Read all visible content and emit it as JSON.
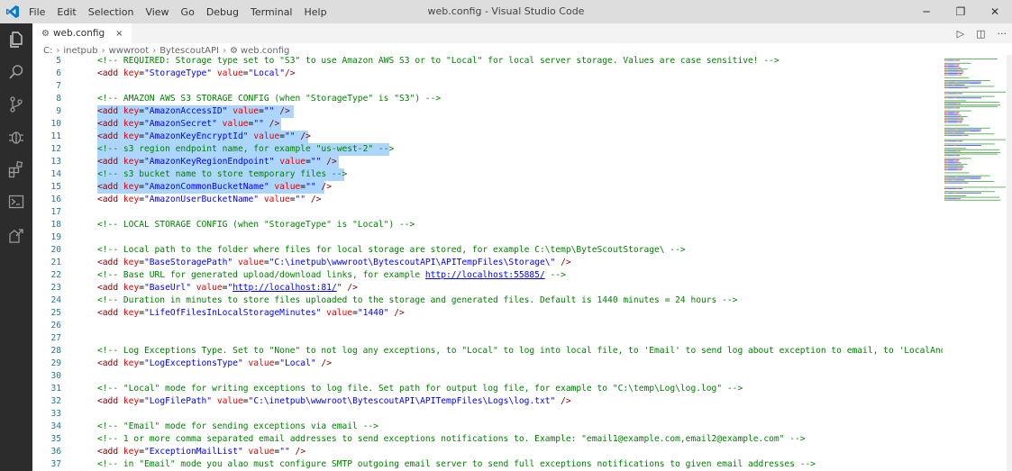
{
  "window": {
    "title": "web.config - Visual Studio Code",
    "minimize": "─",
    "restore": "❐",
    "close": "✕"
  },
  "menu": [
    "File",
    "Edit",
    "Selection",
    "View",
    "Go",
    "Debug",
    "Terminal",
    "Help"
  ],
  "tab": {
    "label": "web.config",
    "close": "×"
  },
  "breadcrumb": [
    "C:",
    "inetpub",
    "wwwroot",
    "BytescoutAPI",
    "web.config"
  ],
  "editor_actions": {
    "run": "▷",
    "split": "◫",
    "more": "···"
  },
  "lines": [
    {
      "n": "5",
      "parts": [
        [
          "c",
          "<!-- REQUIRED: Storage type set to \"S3\" to use Amazon AWS S3 or to \"Local\" for local server storage. Values are case sensitive! -->"
        ]
      ]
    },
    {
      "n": "6",
      "parts": [
        [
          "t",
          "<add "
        ],
        [
          "a",
          "key"
        ],
        [
          "e",
          "="
        ],
        [
          "v",
          "\"StorageType\""
        ],
        [
          "t",
          " "
        ],
        [
          "a",
          "value"
        ],
        [
          "e",
          "="
        ],
        [
          "v",
          "\"Local\""
        ],
        [
          "t",
          "/>"
        ]
      ]
    },
    {
      "n": "7",
      "parts": []
    },
    {
      "n": "8",
      "parts": [
        [
          "c",
          "<!-- AMAZON AWS S3 STORAGE CONFIG (when \"StorageType\" is \"S3\") -->"
        ]
      ]
    },
    {
      "n": "9",
      "parts": [
        [
          "t",
          "<add "
        ],
        [
          "a",
          "key"
        ],
        [
          "e",
          "="
        ],
        [
          "v",
          "\"AmazonAccessID\""
        ],
        [
          "t",
          " "
        ],
        [
          "a",
          "value"
        ],
        [
          "e",
          "="
        ],
        [
          "v",
          "\"\""
        ],
        [
          "t",
          " />"
        ]
      ]
    },
    {
      "n": "10",
      "parts": [
        [
          "t",
          "<add "
        ],
        [
          "a",
          "key"
        ],
        [
          "e",
          "="
        ],
        [
          "v",
          "\"AmazonSecret\""
        ],
        [
          "t",
          " "
        ],
        [
          "a",
          "value"
        ],
        [
          "e",
          "="
        ],
        [
          "v",
          "\"\""
        ],
        [
          "t",
          " />"
        ]
      ]
    },
    {
      "n": "11",
      "parts": [
        [
          "t",
          "<add "
        ],
        [
          "a",
          "key"
        ],
        [
          "e",
          "="
        ],
        [
          "v",
          "\"AmazonKeyEncryptId\""
        ],
        [
          "t",
          " "
        ],
        [
          "a",
          "value"
        ],
        [
          "e",
          "="
        ],
        [
          "v",
          "\"\""
        ],
        [
          "t",
          " />"
        ]
      ]
    },
    {
      "n": "12",
      "parts": [
        [
          "c",
          "<!-- s3 region endpoint name, for example \"us-west-2\" -->"
        ]
      ]
    },
    {
      "n": "13",
      "parts": [
        [
          "t",
          "<add "
        ],
        [
          "a",
          "key"
        ],
        [
          "e",
          "="
        ],
        [
          "v",
          "\"AmazonKeyRegionEndpoint\""
        ],
        [
          "t",
          " "
        ],
        [
          "a",
          "value"
        ],
        [
          "e",
          "="
        ],
        [
          "v",
          "\"\""
        ],
        [
          "t",
          " />"
        ]
      ]
    },
    {
      "n": "14",
      "parts": [
        [
          "c",
          "<!-- s3 bucket name to store temporary files -->"
        ]
      ]
    },
    {
      "n": "15",
      "parts": [
        [
          "t",
          "<add "
        ],
        [
          "a",
          "key"
        ],
        [
          "e",
          "="
        ],
        [
          "v",
          "\"AmazonCommonBucketName\""
        ],
        [
          "t",
          " "
        ],
        [
          "a",
          "value"
        ],
        [
          "e",
          "="
        ],
        [
          "v",
          "\"\""
        ],
        [
          "t",
          " />"
        ]
      ]
    },
    {
      "n": "16",
      "parts": [
        [
          "t",
          "<add "
        ],
        [
          "a",
          "key"
        ],
        [
          "e",
          "="
        ],
        [
          "v",
          "\"AmazonUserBucketName\""
        ],
        [
          "t",
          " "
        ],
        [
          "a",
          "value"
        ],
        [
          "e",
          "="
        ],
        [
          "v",
          "\"\""
        ],
        [
          "t",
          " />"
        ]
      ]
    },
    {
      "n": "17",
      "parts": []
    },
    {
      "n": "18",
      "parts": [
        [
          "c",
          "<!-- LOCAL STORAGE CONFIG (when \"StorageType\" is \"Local\") -->"
        ]
      ]
    },
    {
      "n": "19",
      "parts": []
    },
    {
      "n": "20",
      "parts": [
        [
          "c",
          "<!-- Local path to the folder where files for local storage are stored, for example C:\\temp\\ByteScoutStorage\\ -->"
        ]
      ]
    },
    {
      "n": "21",
      "parts": [
        [
          "t",
          "<add "
        ],
        [
          "a",
          "key"
        ],
        [
          "e",
          "="
        ],
        [
          "v",
          "\"BaseStoragePath\""
        ],
        [
          "t",
          " "
        ],
        [
          "a",
          "value"
        ],
        [
          "e",
          "="
        ],
        [
          "v",
          "\"C:\\inetpub\\wwwroot\\BytescoutAPI\\APITempFiles\\Storage\\\""
        ],
        [
          "t",
          " />"
        ]
      ]
    },
    {
      "n": "22",
      "parts": [
        [
          "c",
          "<!-- Base URL for generated upload/download links, for example "
        ],
        [
          "u",
          "http://localhost:55885/"
        ],
        [
          "c",
          " -->"
        ]
      ]
    },
    {
      "n": "23",
      "parts": [
        [
          "t",
          "<add "
        ],
        [
          "a",
          "key"
        ],
        [
          "e",
          "="
        ],
        [
          "v",
          "\"BaseUrl\""
        ],
        [
          "t",
          " "
        ],
        [
          "a",
          "value"
        ],
        [
          "e",
          "="
        ],
        [
          "v",
          "\""
        ],
        [
          "u",
          "http://localhost:81/"
        ],
        [
          "v",
          "\""
        ],
        [
          "t",
          " />"
        ]
      ]
    },
    {
      "n": "24",
      "parts": [
        [
          "c",
          "<!-- Duration in minutes to store files uploaded to the storage and generated files. Default is 1440 minutes = 24 hours -->"
        ]
      ]
    },
    {
      "n": "25",
      "parts": [
        [
          "t",
          "<add "
        ],
        [
          "a",
          "key"
        ],
        [
          "e",
          "="
        ],
        [
          "v",
          "\"LifeOfFilesInLocalStorageMinutes\""
        ],
        [
          "t",
          " "
        ],
        [
          "a",
          "value"
        ],
        [
          "e",
          "="
        ],
        [
          "v",
          "\"1440\""
        ],
        [
          "t",
          " />"
        ]
      ]
    },
    {
      "n": "26",
      "parts": []
    },
    {
      "n": "27",
      "parts": []
    },
    {
      "n": "28",
      "parts": [
        [
          "c",
          "<!-- Log Exceptions Type. Set to \"None\" to not log any exceptions, to \"Local\" to log into local file, to 'Email' to send log about exception to email, to 'LocalAndEma"
        ]
      ]
    },
    {
      "n": "29",
      "parts": [
        [
          "t",
          "<add "
        ],
        [
          "a",
          "key"
        ],
        [
          "e",
          "="
        ],
        [
          "v",
          "\"LogExceptionsType\""
        ],
        [
          "t",
          " "
        ],
        [
          "a",
          "value"
        ],
        [
          "e",
          "="
        ],
        [
          "v",
          "\"Local\""
        ],
        [
          "t",
          " />"
        ]
      ]
    },
    {
      "n": "30",
      "parts": []
    },
    {
      "n": "31",
      "parts": [
        [
          "c",
          "<!-- \"Local\" mode for writing exceptions to log file. Set path for output log file, for example to \"C:\\temp\\Log\\log.log\" -->"
        ]
      ]
    },
    {
      "n": "32",
      "parts": [
        [
          "t",
          "<add "
        ],
        [
          "a",
          "key"
        ],
        [
          "e",
          "="
        ],
        [
          "v",
          "\"LogFilePath\""
        ],
        [
          "t",
          " "
        ],
        [
          "a",
          "value"
        ],
        [
          "e",
          "="
        ],
        [
          "v",
          "\"C:\\inetpub\\wwwroot\\BytescoutAPI\\APITempFiles\\Logs\\log.txt\""
        ],
        [
          "t",
          " />"
        ]
      ]
    },
    {
      "n": "33",
      "parts": []
    },
    {
      "n": "34",
      "parts": [
        [
          "c",
          "<!-- \"Email\" mode for sending exceptions via email -->"
        ]
      ]
    },
    {
      "n": "35",
      "parts": [
        [
          "c",
          "<!-- 1 or more comma separated email addresses to send exceptions notifications to. Example: \"email1@example.com,email2@example.com\" -->"
        ]
      ]
    },
    {
      "n": "36",
      "parts": [
        [
          "t",
          "<add "
        ],
        [
          "a",
          "key"
        ],
        [
          "e",
          "="
        ],
        [
          "v",
          "\"ExceptionMailList\""
        ],
        [
          "t",
          " "
        ],
        [
          "a",
          "value"
        ],
        [
          "e",
          "="
        ],
        [
          "v",
          "\"\""
        ],
        [
          "t",
          " />"
        ]
      ]
    },
    {
      "n": "37",
      "parts": [
        [
          "c",
          "<!-- in \"Email\" mode you alao must configure SMTP outgoing email server to send full exceptions notifications to given email addresses -->"
        ]
      ]
    }
  ],
  "selection": {
    "from_line": "9",
    "to_line": "15"
  },
  "colors": {
    "comment": "#008000",
    "tag": "#800000",
    "attr": "#e50000",
    "value": "#0000ff",
    "line_number": "#237893",
    "selection": "#add6ff",
    "activity_bar": "#2c2c2c",
    "title_bar": "#dddddd",
    "vs_blue": "#007acc"
  },
  "icons": [
    "vscode-logo-icon",
    "explorer-icon",
    "search-icon",
    "source-control-icon",
    "debug-icon",
    "extensions-icon",
    "terminal-icon",
    "remote-icon",
    "gear-icon"
  ]
}
